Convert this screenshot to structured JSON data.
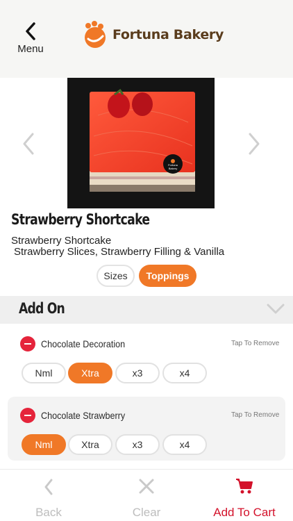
{
  "header": {
    "menu_label": "Menu",
    "brand_name": "Fortuna Bakery",
    "brand_color": "#f07827"
  },
  "product": {
    "title": "Strawberry Shortcake",
    "subtitle": "Strawberry Shortcake",
    "description": "Strawberry Slices, Strawberry Filling & Vanilla",
    "image_badge": [
      "Fortuna",
      "Bakery"
    ]
  },
  "tabs": {
    "sizes": "Sizes",
    "toppings": "Toppings",
    "active": "toppings"
  },
  "addon": {
    "title": "Add On",
    "groups": [
      {
        "name": "Chocolate Decoration",
        "remove_hint": "Tap To Remove",
        "options": [
          "Nml",
          "Xtra",
          "x3",
          "x4"
        ],
        "selected": "Xtra"
      },
      {
        "name": "Chocolate Strawberry",
        "remove_hint": "Tap To Remove",
        "options": [
          "Nml",
          "Xtra",
          "x3",
          "x4"
        ],
        "selected": "Nml"
      }
    ]
  },
  "bottom_nav": {
    "back": "Back",
    "clear": "Clear",
    "add_to_cart": "Add To Cart"
  },
  "colors": {
    "accent": "#f07827",
    "remove": "#e5243b",
    "cart": "#d3122b"
  }
}
